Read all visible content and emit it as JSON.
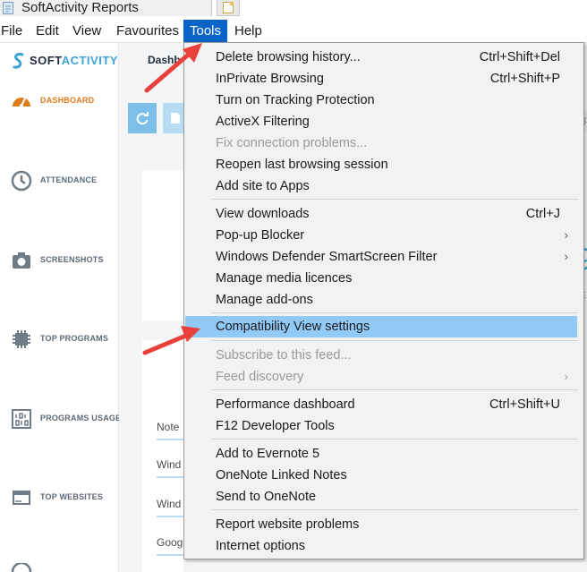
{
  "window": {
    "tab_title": "SoftActivity Reports"
  },
  "menubar": {
    "items": [
      "File",
      "Edit",
      "View",
      "Favourites",
      "Tools",
      "Help"
    ],
    "active": "Tools"
  },
  "app": {
    "logo_prefix": "SOFT",
    "logo_suffix": "ACTIVITY",
    "breadcrumb": "Dashb",
    "nav": [
      {
        "label": "DASHBOARD",
        "icon": "gauge-icon",
        "current": true
      },
      {
        "label": "ATTENDANCE",
        "icon": "clock-icon"
      },
      {
        "label": "SCREENSHOTS",
        "icon": "camera-icon"
      },
      {
        "label": "TOP PROGRAMS",
        "icon": "chip-icon"
      },
      {
        "label": "PROGRAMS USAGE",
        "icon": "binary-icon"
      },
      {
        "label": "TOP WEBSITES",
        "icon": "browser-icon"
      }
    ],
    "rows": [
      "Note",
      "Wind",
      "Wind",
      "Goog"
    ],
    "right_big": "9",
    "right_small": "E",
    "right_grey": "Ap"
  },
  "tools_menu": {
    "groups": [
      [
        {
          "label": "Delete browsing history...",
          "shortcut": "Ctrl+Shift+Del"
        },
        {
          "label": "InPrivate Browsing",
          "shortcut": "Ctrl+Shift+P"
        },
        {
          "label": "Turn on Tracking Protection"
        },
        {
          "label": "ActiveX Filtering"
        },
        {
          "label": "Fix connection problems...",
          "disabled": true
        },
        {
          "label": "Reopen last browsing session"
        },
        {
          "label": "Add site to Apps"
        }
      ],
      [
        {
          "label": "View downloads",
          "shortcut": "Ctrl+J"
        },
        {
          "label": "Pop-up Blocker",
          "submenu": true
        },
        {
          "label": "Windows Defender SmartScreen Filter",
          "submenu": true
        },
        {
          "label": "Manage media licences"
        },
        {
          "label": "Manage add-ons"
        }
      ],
      [
        {
          "label": "Compatibility View settings",
          "highlighted": true
        }
      ],
      [
        {
          "label": "Subscribe to this feed...",
          "disabled": true
        },
        {
          "label": "Feed discovery",
          "disabled": true,
          "submenu": true
        }
      ],
      [
        {
          "label": "Performance dashboard",
          "shortcut": "Ctrl+Shift+U"
        },
        {
          "label": "F12 Developer Tools"
        }
      ],
      [
        {
          "label": "Add to Evernote 5"
        },
        {
          "label": "OneNote Linked Notes"
        },
        {
          "label": "Send to OneNote"
        }
      ],
      [
        {
          "label": "Report website problems"
        },
        {
          "label": "Internet options"
        }
      ]
    ]
  },
  "colors": {
    "menu_active": "#0a64c8",
    "highlight": "#91c9f7",
    "arrow": "#e8413a",
    "accent": "#3ea3d8",
    "dashboard_orange": "#e07b1c"
  }
}
